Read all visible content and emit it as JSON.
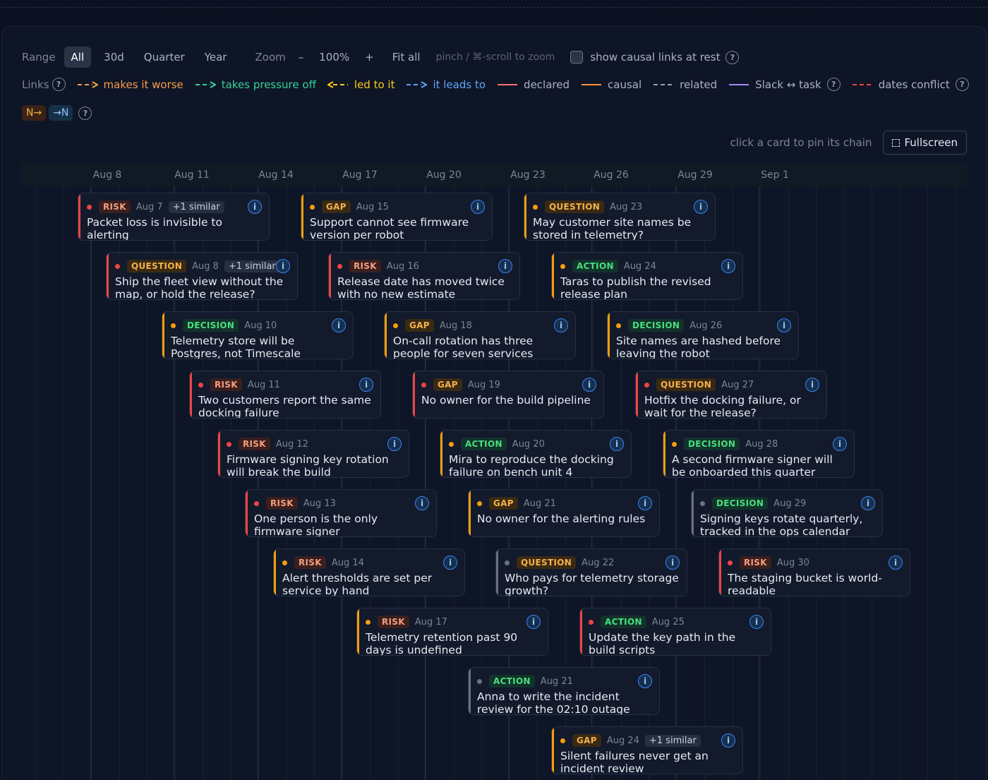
{
  "toolbar": {
    "range_label": "Range",
    "ranges": [
      "All",
      "30d",
      "Quarter",
      "Year"
    ],
    "zoom_label": "Zoom",
    "zoom_minus": "–",
    "zoom_value": "100%",
    "zoom_plus": "+",
    "fit_all": "Fit all",
    "zoom_hint": "pinch / ⌘-scroll to zoom",
    "causal_toggle": "show causal links at rest"
  },
  "legend": {
    "label": "Links",
    "items": [
      {
        "text": "makes it worse",
        "color": "#f59e4a"
      },
      {
        "text": "takes pressure off",
        "color": "#34d399"
      },
      {
        "text": "led to it",
        "color": "#facc15"
      },
      {
        "text": "it leads to",
        "color": "#60a5fa"
      },
      {
        "text": "declared",
        "color": "#f87171"
      },
      {
        "text": "causal",
        "color": "#fb923c"
      },
      {
        "text": "related",
        "color": "#94a3b8"
      },
      {
        "text": "Slack ↔ task",
        "color": "#a78bfa"
      },
      {
        "text": "dates conflict",
        "color": "#ef4444"
      }
    ],
    "tag_in": "N→",
    "tag_out": "→N"
  },
  "view": {
    "pin_hint": "click a card to pin its chain",
    "fullscreen": "Fullscreen"
  },
  "axis": {
    "ticks": [
      "Aug 8",
      "Aug 11",
      "Aug 14",
      "Aug 17",
      "Aug 20",
      "Aug 23",
      "Aug 26",
      "Aug 29",
      "Sep 1"
    ]
  },
  "colors": {
    "red": "#ef4444",
    "orange": "#f59e0b",
    "grey": "#6b7280"
  },
  "cards": [
    {
      "kind": "RISK",
      "date": "Aug 7",
      "similar": "+1 similar",
      "title": "Packet loss is invisible to alerting",
      "accent": "red"
    },
    {
      "kind": "QUESTION",
      "date": "Aug 8",
      "similar": "+1 similar",
      "title": "Ship the fleet view without the map, or hold the release?",
      "accent": "red"
    },
    {
      "kind": "DECISION",
      "date": "Aug 10",
      "similar": "",
      "title": "Telemetry store will be Postgres, not Timescale",
      "accent": "orange"
    },
    {
      "kind": "RISK",
      "date": "Aug 11",
      "similar": "",
      "title": "Two customers report the same docking failure",
      "accent": "red"
    },
    {
      "kind": "RISK",
      "date": "Aug 12",
      "similar": "",
      "title": "Firmware signing key rotation will break the build",
      "accent": "red"
    },
    {
      "kind": "RISK",
      "date": "Aug 13",
      "similar": "",
      "title": "One person is the only firmware signer",
      "accent": "red"
    },
    {
      "kind": "RISK",
      "date": "Aug 14",
      "similar": "",
      "title": "Alert thresholds are set per service by hand",
      "accent": "orange"
    },
    {
      "kind": "GAP",
      "date": "Aug 15",
      "similar": "",
      "title": "Support cannot see firmware version per robot",
      "accent": "orange"
    },
    {
      "kind": "RISK",
      "date": "Aug 16",
      "similar": "",
      "title": "Release date has moved twice with no new estimate",
      "accent": "red"
    },
    {
      "kind": "GAP",
      "date": "Aug 18",
      "similar": "",
      "title": "On-call rotation has three people for seven services",
      "accent": "orange"
    },
    {
      "kind": "GAP",
      "date": "Aug 19",
      "similar": "",
      "title": "No owner for the build pipeline",
      "accent": "red"
    },
    {
      "kind": "ACTION",
      "date": "Aug 20",
      "similar": "",
      "title": "Mira to reproduce the docking failure on bench unit 4",
      "accent": "orange"
    },
    {
      "kind": "GAP",
      "date": "Aug 21",
      "similar": "",
      "title": "No owner for the alerting rules",
      "accent": "orange"
    },
    {
      "kind": "QUESTION",
      "date": "Aug 22",
      "similar": "",
      "title": "Who pays for telemetry storage growth?",
      "accent": "grey"
    },
    {
      "kind": "RISK",
      "date": "Aug 17",
      "similar": "",
      "title": "Telemetry retention past 90 days is undefined",
      "accent": "orange"
    },
    {
      "kind": "ACTION",
      "date": "Aug 21",
      "similar": "",
      "title": "Anna to write the incident review for the 02:10 outage",
      "accent": "grey"
    },
    {
      "kind": "QUESTION",
      "date": "Aug 23",
      "similar": "",
      "title": "May customer site names be stored in telemetry?",
      "accent": "orange"
    },
    {
      "kind": "ACTION",
      "date": "Aug 24",
      "similar": "",
      "title": "Taras to publish the revised release plan",
      "accent": "orange"
    },
    {
      "kind": "DECISION",
      "date": "Aug 26",
      "similar": "",
      "title": "Site names are hashed before leaving the robot",
      "accent": "orange"
    },
    {
      "kind": "QUESTION",
      "date": "Aug 27",
      "similar": "",
      "title": "Hotfix the docking failure, or wait for the release?",
      "accent": "red"
    },
    {
      "kind": "DECISION",
      "date": "Aug 28",
      "similar": "",
      "title": "A second firmware signer will be onboarded this quarter",
      "accent": "orange"
    },
    {
      "kind": "DECISION",
      "date": "Aug 29",
      "similar": "",
      "title": "Signing keys rotate quarterly, tracked in the ops calendar",
      "accent": "grey"
    },
    {
      "kind": "RISK",
      "date": "Aug 30",
      "similar": "",
      "title": "The staging bucket is world-readable",
      "accent": "red"
    },
    {
      "kind": "ACTION",
      "date": "Aug 25",
      "similar": "",
      "title": "Update the key path in the build scripts",
      "accent": "red"
    },
    {
      "kind": "GAP",
      "date": "Aug 24",
      "similar": "+1 similar",
      "title": "Silent failures never get an incident review",
      "accent": "orange"
    }
  ]
}
